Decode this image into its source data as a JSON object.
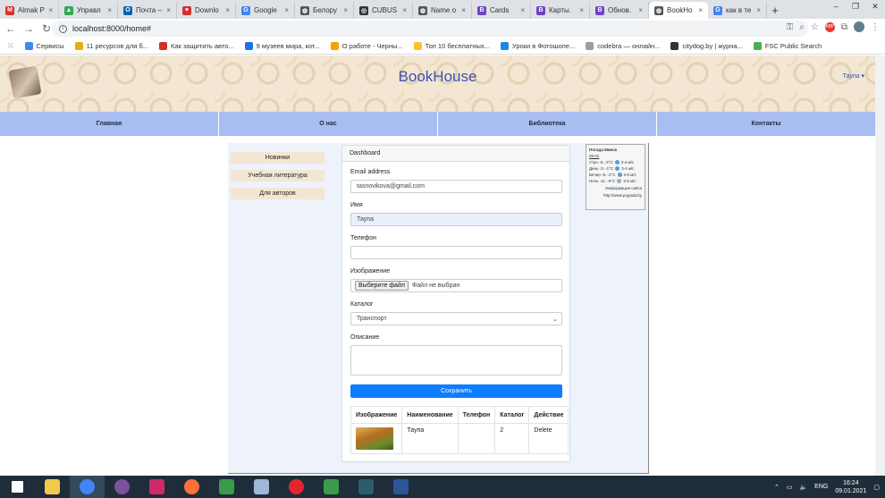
{
  "browser": {
    "tabs": [
      {
        "label": "Almak P",
        "icon": "gmail-icon",
        "color": "#d93025",
        "glyph": "M"
      },
      {
        "label": "Управл",
        "icon": "drive-icon",
        "color": "#34a853",
        "glyph": "▲"
      },
      {
        "label": "Почта –",
        "icon": "outlook-icon",
        "color": "#0a64ad",
        "glyph": "O"
      },
      {
        "label": "Downlo",
        "icon": "heart-icon",
        "color": "#d32f2f",
        "glyph": "♥"
      },
      {
        "label": "Google",
        "icon": "google-docs-icon",
        "color": "#4285f4",
        "glyph": "G"
      },
      {
        "label": "Белору",
        "icon": "globe-icon",
        "color": "#555555",
        "glyph": "◍"
      },
      {
        "label": "CUBUS",
        "icon": "cubus-icon",
        "color": "#333333",
        "glyph": "◎"
      },
      {
        "label": "Name o",
        "icon": "globe-icon",
        "color": "#555555",
        "glyph": "◍"
      },
      {
        "label": "Cards",
        "icon": "bootstrap-icon",
        "color": "#6f42c1",
        "glyph": "B"
      },
      {
        "label": "Карты.",
        "icon": "bootstrap-icon",
        "color": "#6f42c1",
        "glyph": "B"
      },
      {
        "label": "Обнов.",
        "icon": "bootstrap-icon",
        "color": "#6f42c1",
        "glyph": "B"
      },
      {
        "label": "BookHo",
        "icon": "globe-icon",
        "color": "#555555",
        "glyph": "◍",
        "active": true
      },
      {
        "label": "как в те",
        "icon": "google-icon",
        "color": "#4285f4",
        "glyph": "G"
      }
    ],
    "new_tab": "+",
    "url": "localhost:8000/home#",
    "window_controls": [
      "–",
      "❐",
      "✕"
    ]
  },
  "bookmarks": [
    {
      "label": "Сервисы",
      "color": "#4285f4"
    },
    {
      "label": "11 ресурсов для б...",
      "color": "#e2b10d"
    },
    {
      "label": "Как защитить авто...",
      "color": "#d32f2f"
    },
    {
      "label": "9 музеев мира, кот...",
      "color": "#1a73e8"
    },
    {
      "label": "О работе - Черны...",
      "color": "#f4a300"
    },
    {
      "label": "Топ 10 бесплатных...",
      "color": "#fbc02d"
    },
    {
      "label": "Уроки в Фотошопе...",
      "color": "#1e88e5"
    },
    {
      "label": "codebra — онлайн...",
      "color": "#9e9e9e"
    },
    {
      "label": "citydog.by | журна...",
      "color": "#333333"
    },
    {
      "label": "FSC Public Search",
      "color": "#4caf50"
    }
  ],
  "site": {
    "title": "BookHouse",
    "user_menu": "Таупа ▾",
    "menu": [
      "Главная",
      "О нас",
      "Библиотека",
      "Контакты"
    ],
    "sidebar": [
      "Новинки",
      "Учебная литература",
      "Для авторов"
    ]
  },
  "dashboard": {
    "header": "Dashboard",
    "email_label": "Email address",
    "email_value": "tasnovikova@gmail.com",
    "name_label": "Имя",
    "name_value": "Таупа",
    "phone_label": "Телефон",
    "phone_value": "",
    "image_label": "Изображение",
    "file_button": "Выберите файл",
    "file_status": "Файл не выбран",
    "catalog_label": "Каталог",
    "catalog_value": "Транспорт",
    "description_label": "Описание",
    "save_button": "Сохранить",
    "table": {
      "columns": [
        "Изображение",
        "Наименование",
        "Телефон",
        "Каталог",
        "Действие"
      ],
      "rows": [
        {
          "name": "Таупа",
          "phone": "",
          "catalog": "2",
          "action": "Delete"
        }
      ]
    }
  },
  "weather": {
    "title": "Погода Минск",
    "date": "09.01",
    "rows": [
      {
        "label": "Утро -5..-3°C",
        "wind": "3-4 м/с"
      },
      {
        "label": "День -3..-1°C",
        "wind": "3-4 м/с"
      },
      {
        "label": "Вечер -6..-4°C",
        "wind": "3-5 м/с"
      },
      {
        "label": "Ночь -11..-9°C",
        "wind": "3-5 м/с"
      }
    ],
    "source_label": "Информация сайта",
    "source_url": "http://www.pogoda.by"
  },
  "taskbar": {
    "apps": [
      {
        "name": "start-icon",
        "color": "#ffffff"
      },
      {
        "name": "file-explorer-icon",
        "color": "#f2c94c"
      },
      {
        "name": "chrome-icon",
        "color": "#4285f4",
        "active": true
      },
      {
        "name": "viber-icon",
        "color": "#7b519d"
      },
      {
        "name": "indesign-icon",
        "color": "#cc2c6b"
      },
      {
        "name": "firefox-icon",
        "color": "#ff7139"
      },
      {
        "name": "photo-app-icon",
        "color": "#3a9b4b"
      },
      {
        "name": "notepad-icon",
        "color": "#9fb8d8"
      },
      {
        "name": "opera-icon",
        "color": "#e0252d"
      },
      {
        "name": "photo-app-icon-2",
        "color": "#3a9b4b"
      },
      {
        "name": "terminal-icon",
        "color": "#2a5d6e"
      },
      {
        "name": "word-icon",
        "color": "#2b5797"
      }
    ],
    "lang": "ENG",
    "time": "16:24",
    "date": "09.01.2021"
  }
}
